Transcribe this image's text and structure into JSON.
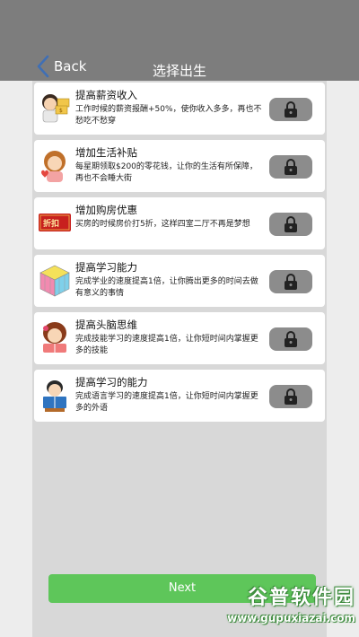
{
  "header": {
    "back_label": "Back",
    "title": "选择出生"
  },
  "items": [
    {
      "title": "提高薪资收入",
      "desc": "工作时候的薪资报酬+50%，使你收入多多，再也不愁吃不愁穿"
    },
    {
      "title": "增加生活补贴",
      "desc": "每星期领取$200的零花钱，让你的生活有所保障，再也不会睡大街"
    },
    {
      "title": "增加购房优惠",
      "desc": "买房的时候房价打5折，这样四室二厅不再是梦想"
    },
    {
      "title": "提高学习能力",
      "desc": "完成学业的速度提高1倍，让你腾出更多的时间去做有意义的事情"
    },
    {
      "title": "提高头脑思维",
      "desc": "完成技能学习的速度提高1倍，让你短时间内掌握更多的技能"
    },
    {
      "title": "提高学习的能力",
      "desc": "完成语言学习的速度提高1倍，让你短时间内掌握更多的外语"
    }
  ],
  "badge_text": "折扣",
  "next_label": "Next",
  "watermark": {
    "top": "谷普软件园",
    "bottom": "www.gupuxiazai.com"
  },
  "colors": {
    "header": "#7d7d7d",
    "next": "#5ec65a",
    "lock": "#8c8c8c",
    "back_chevron": "#3f6fb5"
  },
  "icons": [
    "chevron-left-icon",
    "lock-icon",
    "money-person-icon",
    "girl-heart-icon",
    "discount-badge-icon",
    "rubiks-cube-icon",
    "girl-reading-icon",
    "boy-reading-icon"
  ]
}
